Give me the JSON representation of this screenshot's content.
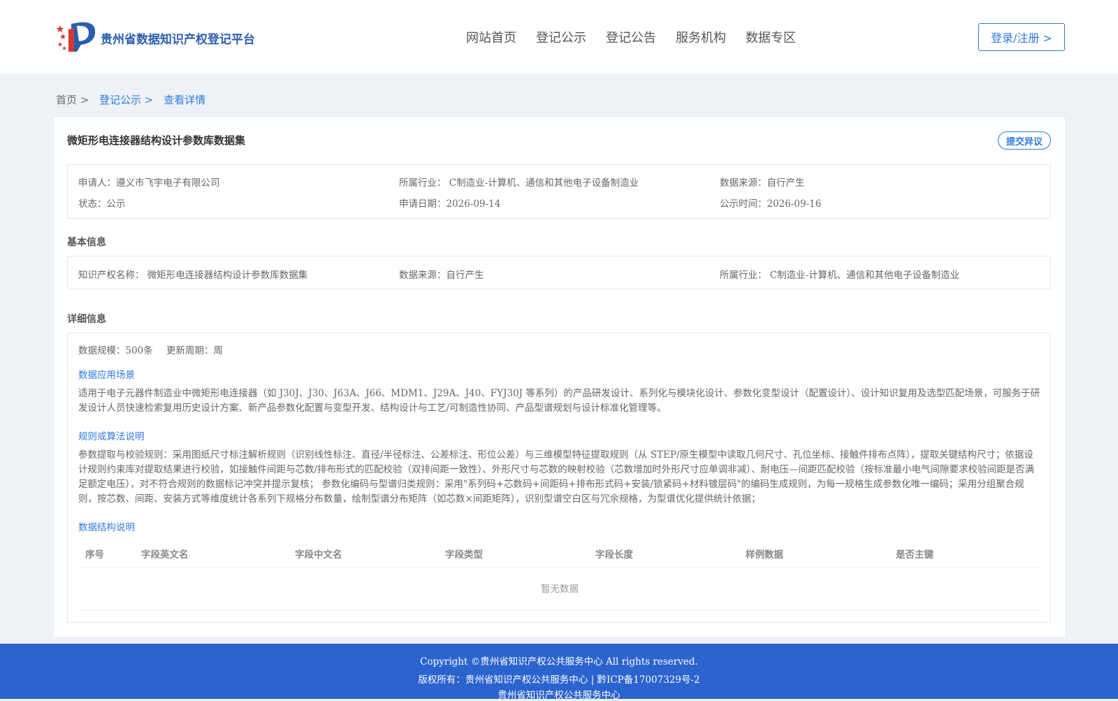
{
  "header": {
    "brand": "贵州省数据知识产权登记平台",
    "nav": [
      "网站首页",
      "登记公示",
      "登记公告",
      "服务机构",
      "数据专区"
    ],
    "login_label": "登录/注册 >"
  },
  "breadcrumb": {
    "home": "首页 >",
    "list": "登记公示 >",
    "current": "查看详情"
  },
  "detail": {
    "title": "微矩形电连接器结构设计参数库数据集",
    "objection_label": "提交异议",
    "summary": {
      "applicant": "申请人：遵义市飞宇电子有限公司",
      "industry": "所属行业： C制造业-计算机、通信和其他电子设备制造业",
      "source": "数据来源：自行产生",
      "status": "状态：公示",
      "apply_date": "申请日期：2026-09-14",
      "publish_date": "公示时间：2026-09-16"
    },
    "basic_title": "基本信息",
    "basic": {
      "name": "知识产权名称： 微矩形电连接器结构设计参数库数据集",
      "source": "数据来源：自行产生",
      "industry": "所属行业： C制造业-计算机、通信和其他电子设备制造业"
    },
    "detail_title": "详细信息",
    "scale": "数据规模：500条",
    "period": "更新周期：周",
    "scenario_title": "数据应用场景",
    "scenario_text": "适用于电子元器件制造业中微矩形电连接器（如 J30J、J30、J63A、J66、MDM1、J29A、J40、FYJ30J 等系列）的产品研发设计、系列化与模块化设计、参数化变型设计（配置设计）、设计知识复用及选型匹配场景，可服务于研发设计人员快速检索复用历史设计方案、新产品参数化配置与变型开发、结构设计与工艺/可制造性协同、产品型谱规划与设计标准化管理等。",
    "rule_title": "规则或算法说明",
    "rule_text": "参数提取与校验规则：采用图纸尺寸标注解析规则（识别线性标注、直径/半径标注、公差标注、形位公差）与三维模型特征提取规则（从 STEP/原生模型中读取几何尺寸、孔位坐标、接触件排布点阵），提取关键结构尺寸；依据设计规则约束库对提取结果进行校验，如接触件间距与芯数/排布形式的匹配校验（双排间距一致性）、外形尺寸与芯数的映射校验（芯数增加时外形尺寸应单调非减）、耐电压—间距匹配校验（按标准最小电气间隙要求校验间距是否满足额定电压），对不符合规则的数据标记冲突并提示复核； 参数化编码与型谱归类规则：采用\"系列码+芯数码+间距码+排布形式码+安装/锁紧码+材料镀层码\"的编码生成规则，为每一规格生成参数化唯一编码；采用分组聚合规则，按芯数、间距、安装方式等维度统计各系列下规格分布数量，绘制型谱分布矩阵（如芯数×间距矩阵），识别型谱空白区与冗余规格，为型谱优化提供统计依据；",
    "structure_title": "数据结构说明",
    "table_headers": [
      "序号",
      "字段英文名",
      "字段中文名",
      "字段类型",
      "字段长度",
      "样例数据",
      "是否主键"
    ],
    "empty_text": "暂无数据"
  },
  "footer": {
    "line1": "Copyright ©贵州省知识产权公共服务中心 All rights reserved.",
    "line2": "版权所有：贵州省知识产权公共服务中心 | 黔ICP备17007329号-2",
    "line3": "贵州省知识产权公共服务中心"
  }
}
